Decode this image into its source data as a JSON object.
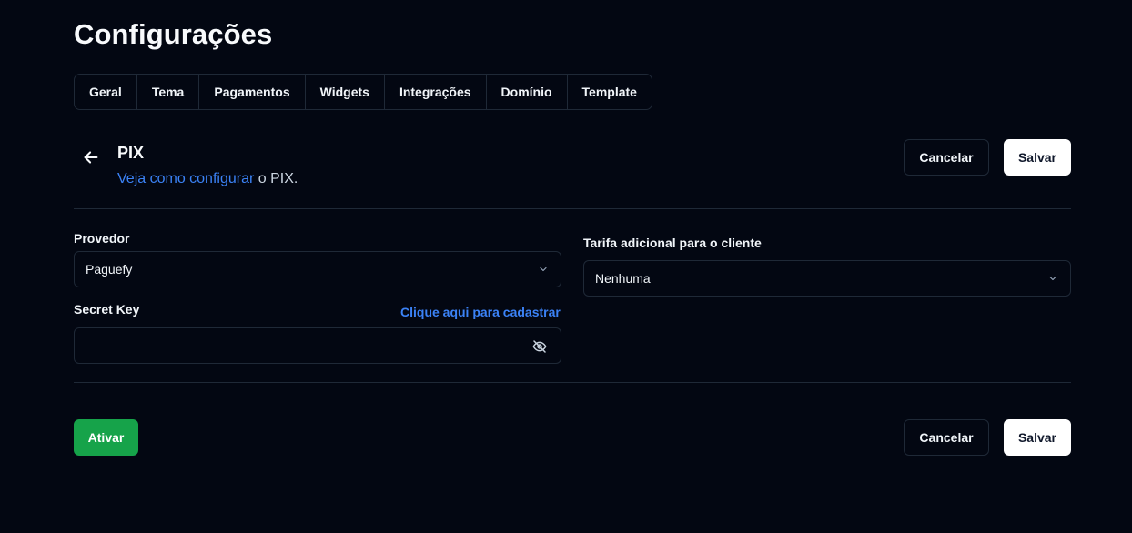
{
  "page": {
    "title": "Configurações"
  },
  "tabs": [
    {
      "label": "Geral"
    },
    {
      "label": "Tema"
    },
    {
      "label": "Pagamentos"
    },
    {
      "label": "Widgets"
    },
    {
      "label": "Integrações"
    },
    {
      "label": "Domínio"
    },
    {
      "label": "Template"
    }
  ],
  "section": {
    "title": "PIX",
    "subtitle_link": "Veja como configurar",
    "subtitle_rest": " o PIX."
  },
  "actions": {
    "cancel_label": "Cancelar",
    "save_label": "Salvar",
    "activate_label": "Ativar"
  },
  "form": {
    "provider": {
      "label": "Provedor",
      "value": "Paguefy"
    },
    "secret_key": {
      "label": "Secret Key",
      "register_link": "Clique aqui para cadastrar",
      "value": ""
    },
    "fee": {
      "label": "Tarifa adicional para o cliente",
      "value": "Nenhuma"
    }
  },
  "colors": {
    "background": "#030712",
    "border": "#1f2937",
    "link": "#3b82f6",
    "activate": "#16a34a"
  },
  "icons": {
    "back": "arrow-left-icon",
    "select": "chevron-down-icon",
    "visibility": "eye-off-icon"
  }
}
